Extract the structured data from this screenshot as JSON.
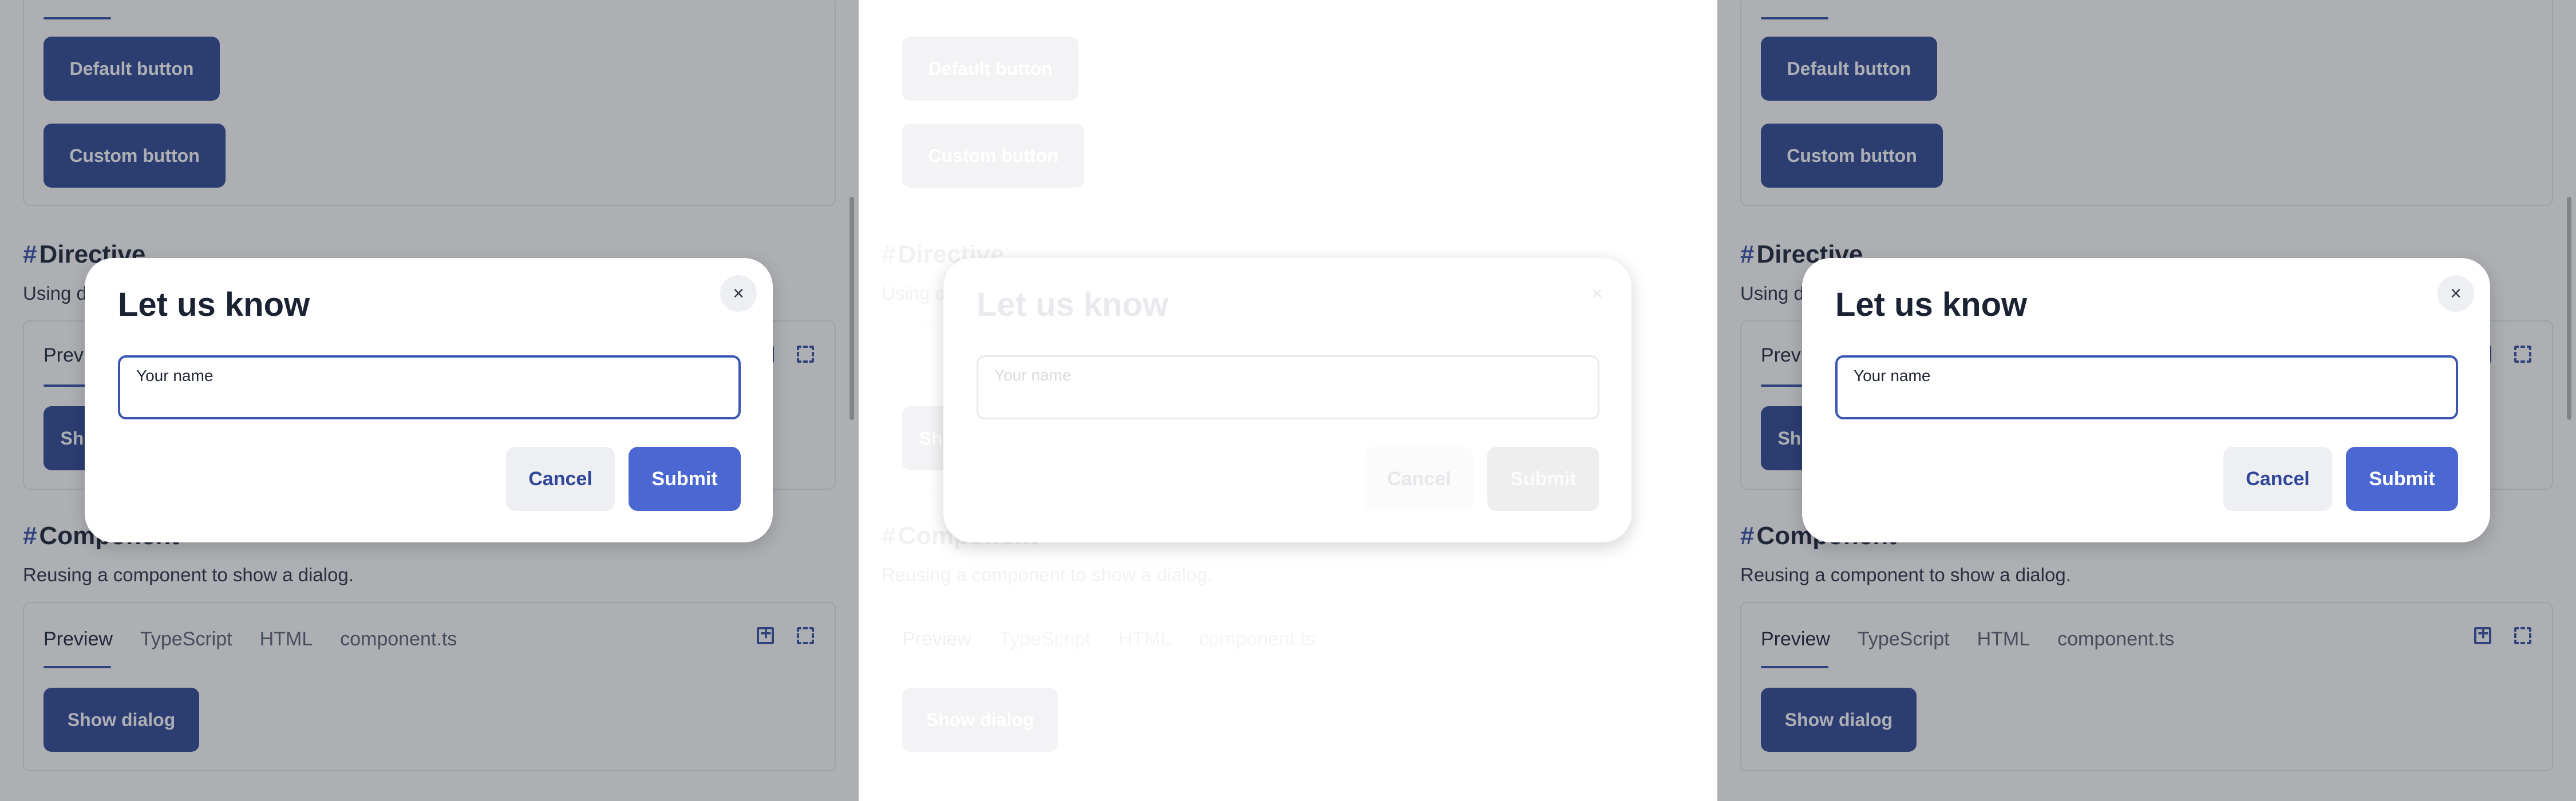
{
  "top_card": {
    "default_button": "Default button",
    "custom_button": "Custom button"
  },
  "directive": {
    "heading": "Directive",
    "description_prefix": "Using d",
    "tab_preview_prefix": "Previe",
    "show_button_prefix": "Sh"
  },
  "component": {
    "heading": "Component",
    "description": "Reusing a component to show a dialog.",
    "tabs": [
      "Preview",
      "TypeScript",
      "HTML",
      "component.ts"
    ],
    "show_button": "Show dialog"
  },
  "dialog": {
    "title": "Let us know",
    "close_symbol": "×",
    "field_label": "Your name",
    "field_value": "",
    "cancel": "Cancel",
    "submit": "Submit"
  },
  "hash_symbol": "#",
  "colors": {
    "accent": "#3650a8",
    "primary_button": "#2f4797",
    "submit_button": "#4b67d1"
  }
}
